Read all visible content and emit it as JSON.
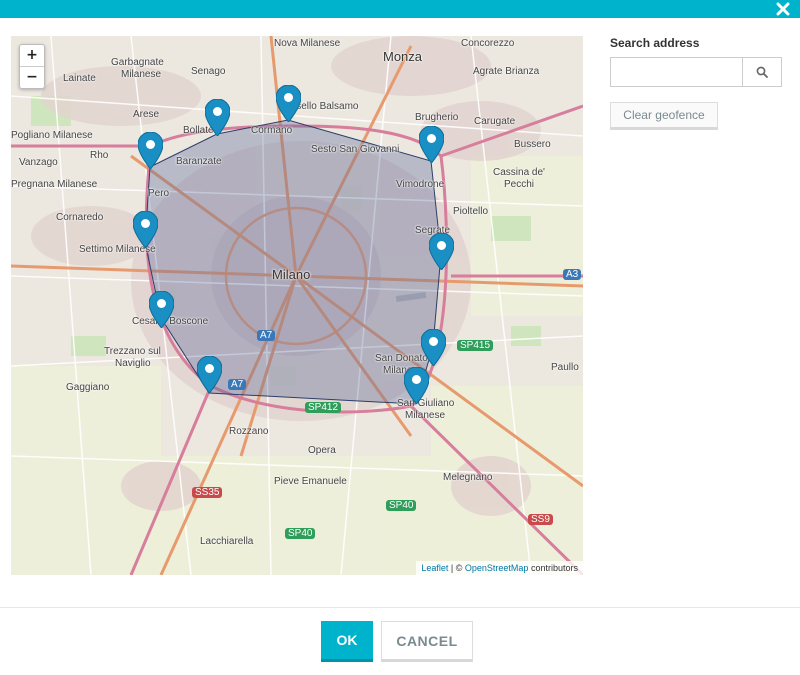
{
  "header": {
    "close_icon": "close-icon",
    "accent": "#00b3cc"
  },
  "map": {
    "zoom_in": "+",
    "zoom_out": "−",
    "places": {
      "nova_milanese": "Nova Milanese",
      "monza": "Monza",
      "concorezzo": "Concorezzo",
      "garbagnate": "Garbagnate",
      "garbagnate2": "Milanese",
      "senago": "Senago",
      "lainate": "Lainate",
      "agrate_brianza": "Agrate Brianza",
      "cinisello": "Cinisello Balsamo",
      "arese": "Arese",
      "bollate": "Bollate",
      "cormano": "Cormano",
      "brugherio": "Brugherio",
      "carugate": "Carugate",
      "rogliano_milanese": "Pogliano Milanese",
      "rho": "Rho",
      "baranzate": "Baranzate",
      "sesto": "Sesto San Giovanni",
      "bussero": "Bussero",
      "vanzago": "Vanzago",
      "pero": "Pero",
      "vimodrone": "Vimodrone",
      "cassina1": "Cassina de'",
      "cassina2": "Pecchi",
      "pregnana": "Pregnana Milanese",
      "cornaredo": "Cornaredo",
      "pioltello": "Pioltello",
      "segrate": "Segrate",
      "settimo": "Settimo Milanese",
      "milano": "Milano",
      "cesano": "Cesano Boscone",
      "trezzano1": "Trezzano sul",
      "trezzano2": "Naviglio",
      "san_donato1": "San Donato",
      "san_donato2": "Milanese",
      "paullo": "Paullo",
      "gaggiano": "Gaggiano",
      "san_giuliano1": "San Giuliano",
      "san_giuliano2": "Milanese",
      "rozzano": "Rozzano",
      "opera": "Opera",
      "pieve": "Pieve Emanuele",
      "melegnano": "Melegnano",
      "lacchiarella": "Lacchiarella"
    },
    "roads": {
      "sp415": "SP415",
      "sp412": "SP412",
      "ss35": "SS35",
      "sp40a": "SP40",
      "sp40b": "SP40",
      "ss9": "SS9",
      "a7a": "A7",
      "a7b": "A7",
      "a3": "A3"
    },
    "attribution": {
      "leaflet": "Leaflet",
      "separator": "| ©",
      "osm": "OpenStreetMap",
      "contributors": "contributors"
    }
  },
  "search": {
    "label": "Search address",
    "value": "",
    "placeholder": "",
    "button_icon": "search-icon"
  },
  "clear_label": "Clear geofence",
  "footer": {
    "ok_label": "OK",
    "cancel_label": "CANCEL"
  },
  "colors": {
    "accent": "#00b3cc",
    "marker": "#1a8fc4",
    "polygon_fill": "#5a6a9a",
    "polygon_stroke": "#2c3e6b"
  },
  "geofence_point_count": 11
}
